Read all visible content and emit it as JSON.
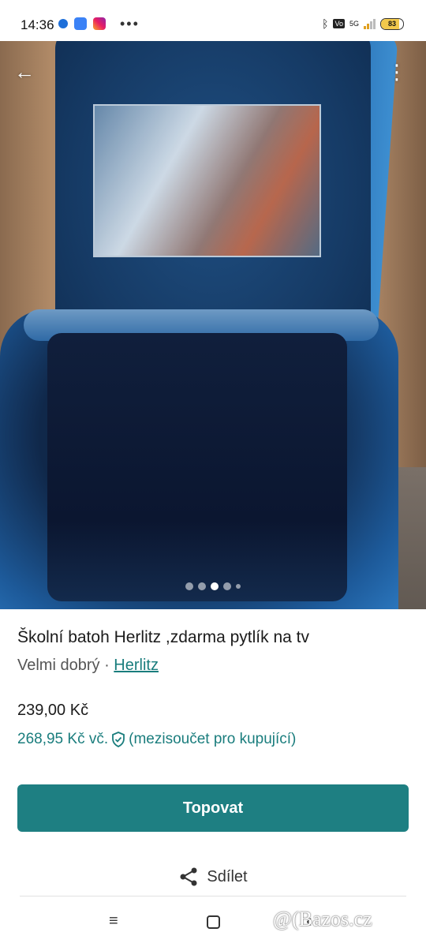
{
  "status_bar": {
    "time": "14:36",
    "dots": "•••",
    "battery": "83",
    "network": "5G"
  },
  "photo": {
    "pager_total": 5,
    "pager_active": 3
  },
  "listing": {
    "title": "Školní batoh Herlitz ,zdarma pytlík na tv",
    "condition": "Velmi dobrý",
    "separator": "·",
    "brand": "Herlitz",
    "price": "239,00 Kč",
    "buyer_price": "268,95 Kč vč.",
    "buyer_note": "(mezisoučet pro kupující)"
  },
  "actions": {
    "promote_label": "Topovat",
    "share_label": "Sdílet"
  },
  "nav": {
    "menu": "≡",
    "back": "‹"
  },
  "watermark": "@(Bazos.cz",
  "colors": {
    "accent": "#1e7f82",
    "link": "#1a7d7d"
  }
}
